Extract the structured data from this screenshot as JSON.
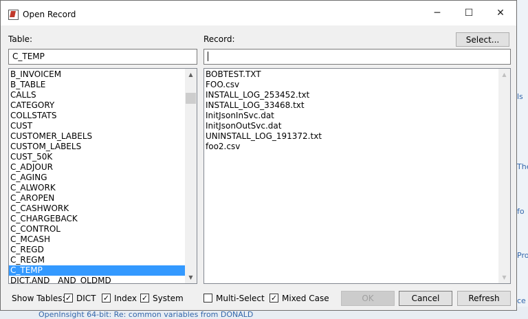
{
  "window": {
    "title": "Open Record",
    "minimize_glyph": "─",
    "maximize_glyph": "☐",
    "close_glyph": "✕"
  },
  "table": {
    "label": "Table:",
    "value": "C_TEMP",
    "items": [
      "B_INVOICEM",
      "B_TABLE",
      "CALLS",
      "CATEGORY",
      "COLLSTATS",
      "CUST",
      "CUSTOMER_LABELS",
      "CUSTOM_LABELS",
      "CUST_50K",
      "C_ADJOUR",
      "C_AGING",
      "C_ALWORK",
      "C_AROPEN",
      "C_CASHWORK",
      "C_CHARGEBACK",
      "C_CONTROL",
      "C_MCASH",
      "C_REGD",
      "C_REGM",
      "C_TEMP",
      "DICT.AND__AND_OLDMD"
    ],
    "selected": "C_TEMP"
  },
  "record": {
    "label": "Record:",
    "value": "",
    "items": [
      "BOBTEST.TXT",
      "FOO.csv",
      "INSTALL_LOG_253452.txt",
      "INSTALL_LOG_33468.txt",
      "InitJsonInSvc.dat",
      "InitJsonOutSvc.dat",
      "UNINSTALL_LOG_191372.txt",
      "foo2.csv"
    ]
  },
  "select_button": "Select...",
  "show_tables": {
    "label": "Show Tables:",
    "dict": {
      "label": "DICT",
      "checked": true
    },
    "index": {
      "label": "Index",
      "checked": true
    },
    "system": {
      "label": "System",
      "checked": true
    }
  },
  "multi_select": {
    "label": "Multi-Select",
    "checked": false
  },
  "mixed_case": {
    "label": "Mixed Case",
    "checked": true
  },
  "buttons": {
    "ok": "OK",
    "cancel": "Cancel",
    "refresh": "Refresh"
  },
  "background": {
    "side_text": [
      "ls",
      "The",
      "fo",
      "Proc",
      "ce A"
    ],
    "bottom_text": "OpenInsight 64-bit: Re: common variables from DONALD"
  },
  "colors": {
    "selection": "#3399ff",
    "dialog_bg": "#f0f0f0"
  }
}
